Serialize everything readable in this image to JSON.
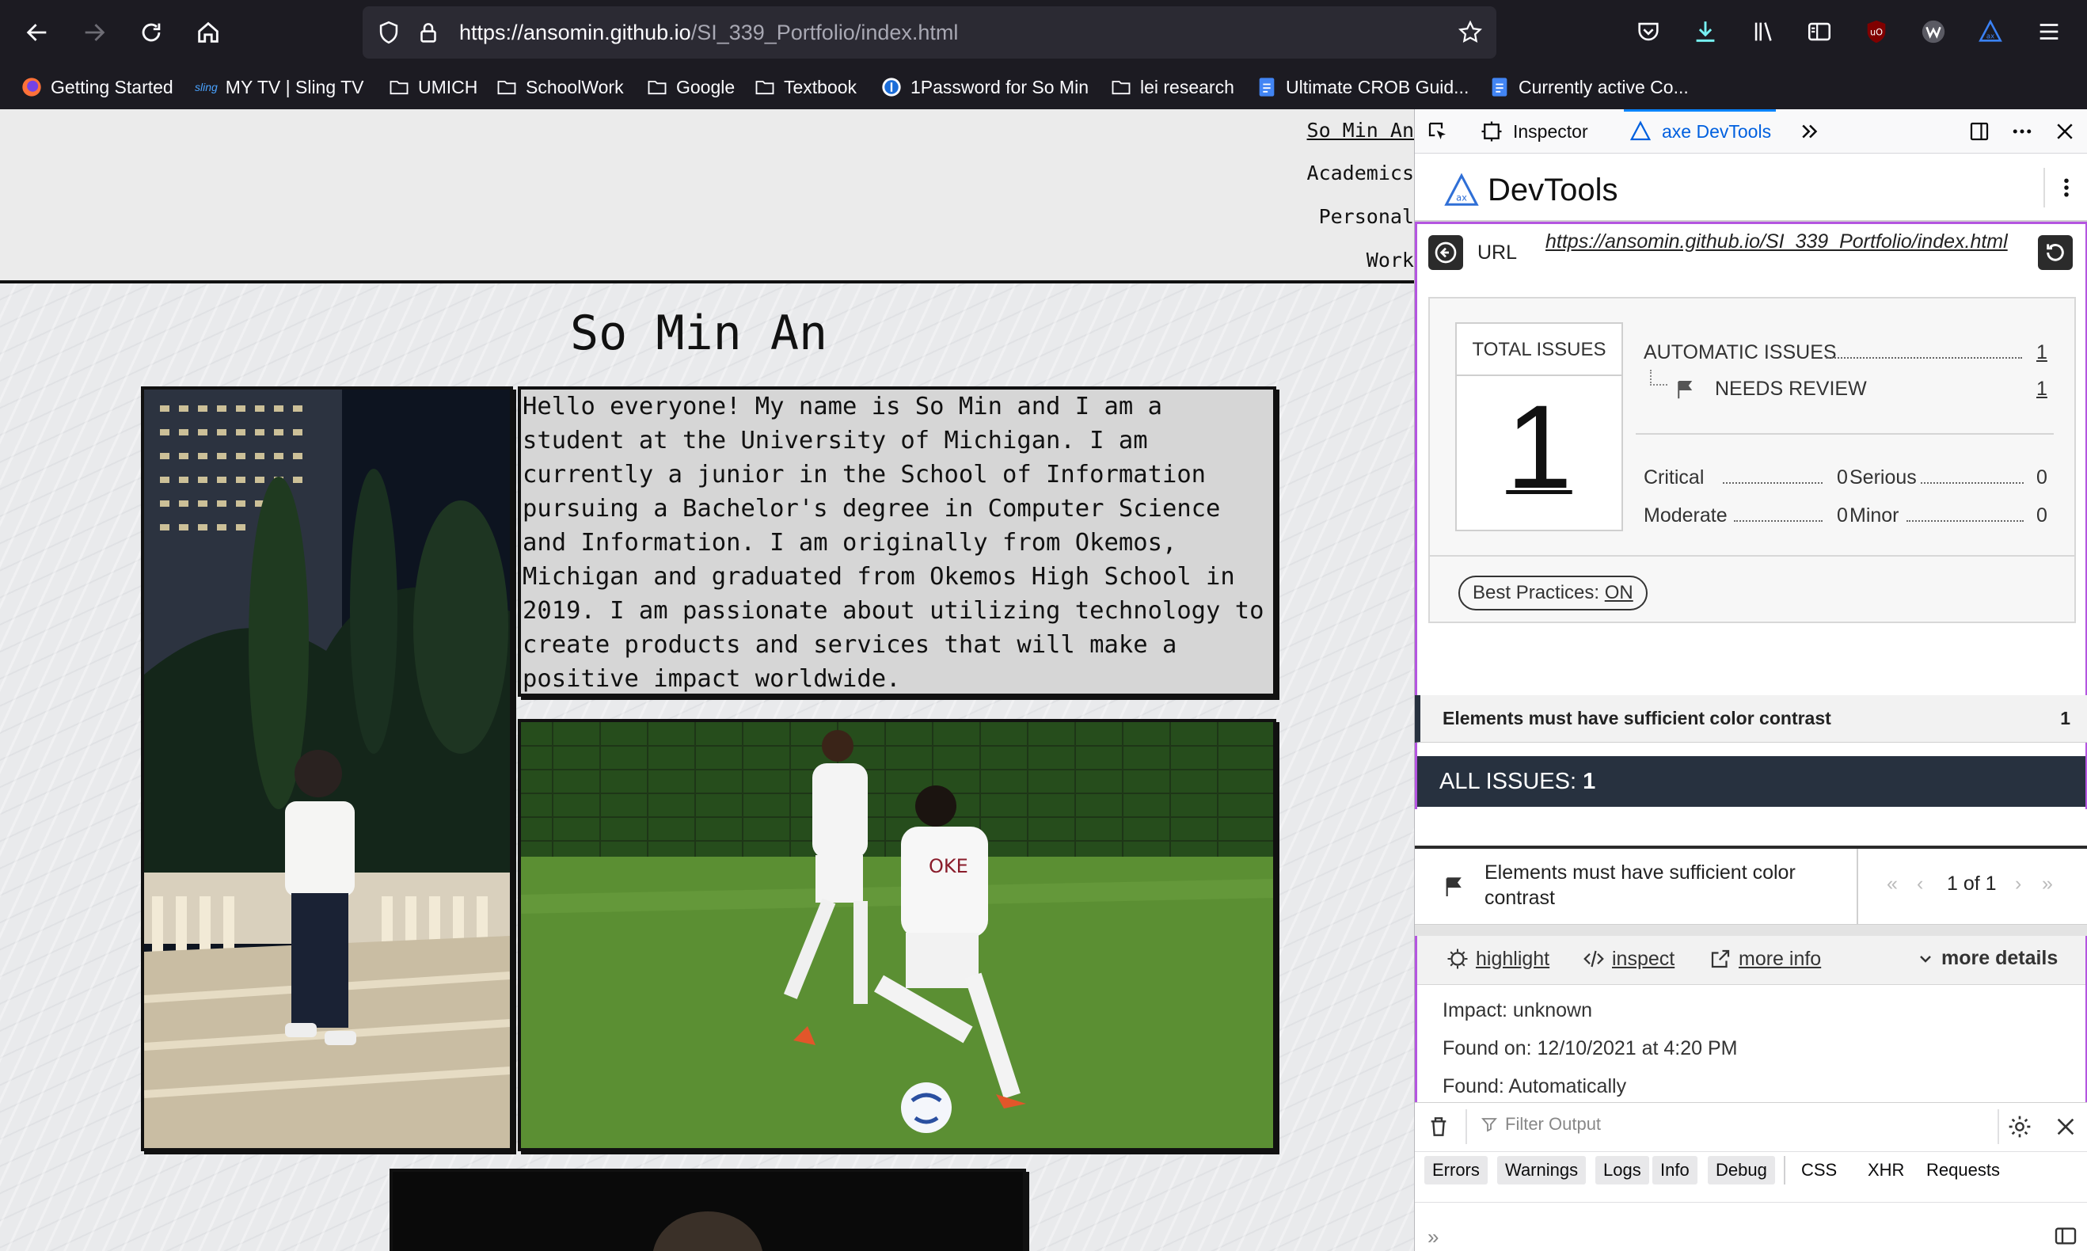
{
  "browser": {
    "url_host": "https://ansomin.github.io",
    "url_path": "/SI_339_Portfolio/index.html",
    "bookmarks": [
      "Getting Started",
      "MY TV | Sling TV",
      "UMICH",
      "SchoolWork",
      "Google",
      "Textbook",
      "1Password for So Min",
      "lei research",
      "Ultimate CROB Guid...",
      "Currently active Co..."
    ],
    "sling_badge": "sling"
  },
  "site": {
    "nav": [
      "So Min An",
      "Academics",
      "Personal",
      "Work"
    ],
    "title": "So Min An",
    "bio": "Hello everyone! My name is So Min and I am a student at the University of Michigan. I am currently a junior in the School of Information pursuing a Bachelor's degree in Computer Science and Information. I am originally from Okemos, Michigan and graduated from Okemos High School in 2019. I am passionate about utilizing technology to create products and services that will make a positive impact worldwide."
  },
  "devtools": {
    "tabs": {
      "inspector": "Inspector",
      "axe": "axe DevTools"
    },
    "axe_title": "DevTools",
    "axe_logo_text": "ax",
    "url_label": "URL",
    "url_value": "https://ansomin.github.io/SI_339_Portfolio/index.html",
    "total_issues_label": "TOTAL ISSUES",
    "total_issues_value": "1",
    "automatic_issues_label": "AUTOMATIC ISSUES",
    "automatic_issues_value": "1",
    "needs_review_label": "NEEDS REVIEW",
    "needs_review_value": "1",
    "critical_label": "Critical",
    "critical_value": "0",
    "serious_label": "Serious",
    "serious_value": "0",
    "moderate_label": "Moderate",
    "moderate_value": "0",
    "minor_label": "Minor",
    "minor_value": "0",
    "best_practices_label": "Best Practices:",
    "best_practices_value": "ON",
    "all_issues_label": "ALL ISSUES:",
    "all_issues_value": "1",
    "issue_row_label": "Elements must have sufficient color contrast",
    "issue_row_count": "1",
    "detail_title": "Elements must have sufficient color contrast",
    "pager_text": "1 of 1",
    "highlight": "highlight",
    "inspect": "inspect",
    "more_info": "more info",
    "more_details": "more details",
    "impact": "Impact: unknown",
    "found_on": "Found on: 12/10/2021 at 4:20 PM",
    "found": "Found: Automatically",
    "filter_placeholder": "Filter Output",
    "console_filters": [
      "Errors",
      "Warnings",
      "Logs",
      "Info",
      "Debug"
    ],
    "console_extra": [
      "CSS",
      "XHR",
      "Requests"
    ],
    "accent": "#b455e0",
    "dark_bar": "#27313f"
  }
}
